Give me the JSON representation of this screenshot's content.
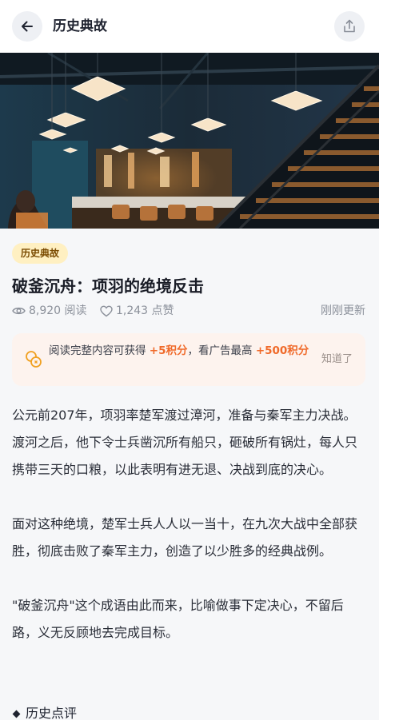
{
  "header": {
    "title": "历史典故",
    "back_icon": "arrow-left-icon",
    "share_icon": "share-icon"
  },
  "hero": {
    "alt": "restaurant-interior-photo"
  },
  "article": {
    "tag": "历史典故",
    "title": "破釜沉舟：项羽的绝境反击",
    "views": "8,920 阅读",
    "likes": "1,243 点赞",
    "updated": "刚刚更新"
  },
  "banner": {
    "icon": "coins-icon",
    "text_prefix": "阅读完整内容可获得 ",
    "reward_read": "+5积分",
    "text_middle": "，看广告最高 ",
    "reward_ad": "+500积分",
    "dismiss_label": "知道了"
  },
  "content": {
    "paragraphs": [
      "公元前207年，项羽率楚军渡过漳河，准备与秦军主力决战。渡河之后，他下令士兵凿沉所有船只，砸破所有锅灶，每人只携带三天的口粮，以此表明有进无退、决战到底的决心。",
      "面对这种绝境，楚军士兵人人以一当十，在九次大战中全部获胜，彻底击败了秦军主力，创造了以少胜多的经典战例。",
      "\"破釜沉舟\"这个成语由此而来，比喻做事下定决心，不留后路，义无反顾地去完成目标。"
    ],
    "section_heading": "历史点评"
  },
  "colors": {
    "accent": "#f06a2a",
    "tag_bg": "#fff0c2",
    "banner_bg": "#fdf3ee"
  }
}
